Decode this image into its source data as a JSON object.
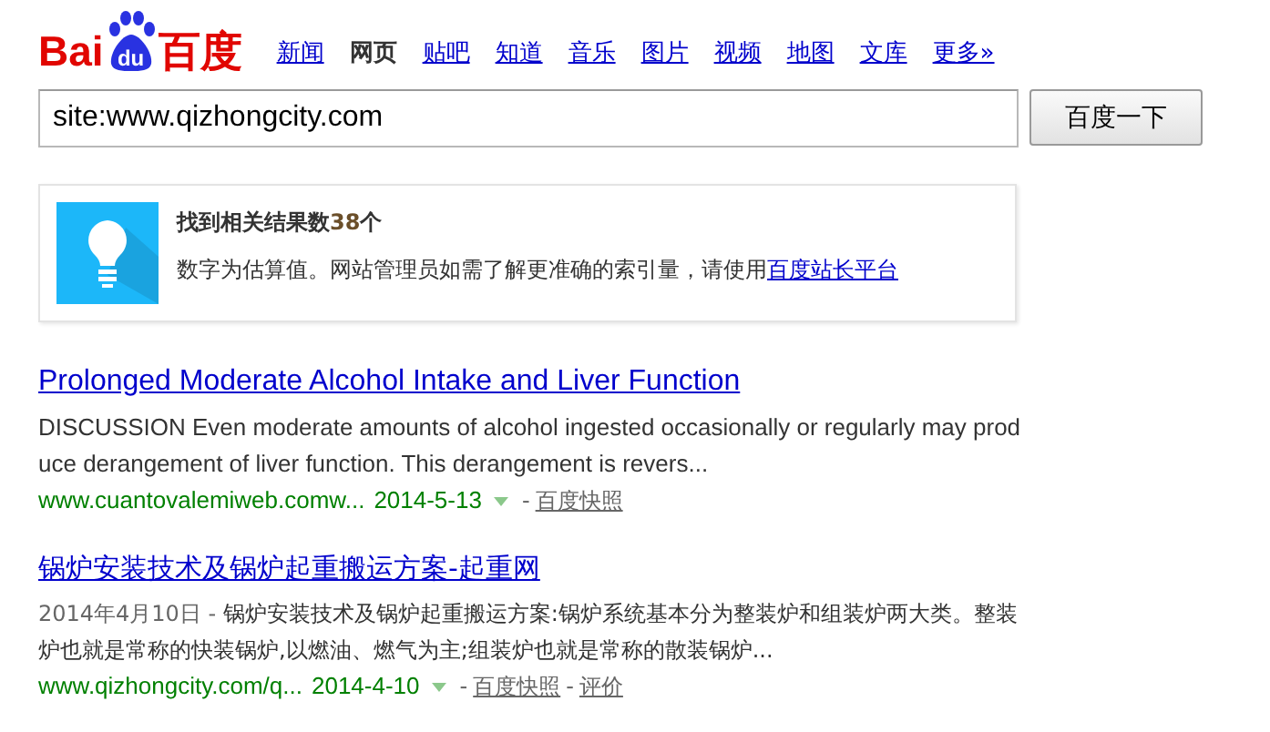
{
  "logo": {
    "left": "Bai",
    "paw": "du",
    "right": "百度"
  },
  "nav": [
    {
      "label": "新闻",
      "selected": false
    },
    {
      "label": "网页",
      "selected": true
    },
    {
      "label": "贴吧",
      "selected": false
    },
    {
      "label": "知道",
      "selected": false
    },
    {
      "label": "音乐",
      "selected": false
    },
    {
      "label": "图片",
      "selected": false
    },
    {
      "label": "视频",
      "selected": false
    },
    {
      "label": "地图",
      "selected": false
    },
    {
      "label": "文库",
      "selected": false
    },
    {
      "label": "更多»",
      "selected": false
    }
  ],
  "search": {
    "value": "site:www.qizhongcity.com",
    "button": "百度一下"
  },
  "info": {
    "count_prefix": "找到相关结果数",
    "count": "38",
    "count_suffix": "个",
    "note": "数字为估算值。网站管理员如需了解更准确的索引量，请使用",
    "link": "百度站长平台"
  },
  "results": [
    {
      "title": "Prolonged Moderate Alcohol Intake and Liver Function",
      "snippet": "DISCUSSION Even moderate amounts of alcohol ingested occasionally or regularly may produce derangement of liver function. This derangement is revers...",
      "url": "www.cuantovalemiweb.comw...",
      "url_date": "2014-5-13",
      "separator": "-",
      "links": [
        "百度快照"
      ]
    },
    {
      "title": "锅炉安装技术及锅炉起重搬运方案-起重网",
      "date": "2014年4月10日 - ",
      "snippet": "锅炉安装技术及锅炉起重搬运方案:锅炉系统基本分为整装炉和组装炉两大类。整装炉也就是常称的快装锅炉,以燃油、燃气为主;组装炉也就是常称的散装锅炉...",
      "url": "www.qizhongcity.com/q...",
      "url_date": "2014-4-10",
      "separator": "-",
      "links": [
        "百度快照",
        "评价"
      ]
    }
  ]
}
